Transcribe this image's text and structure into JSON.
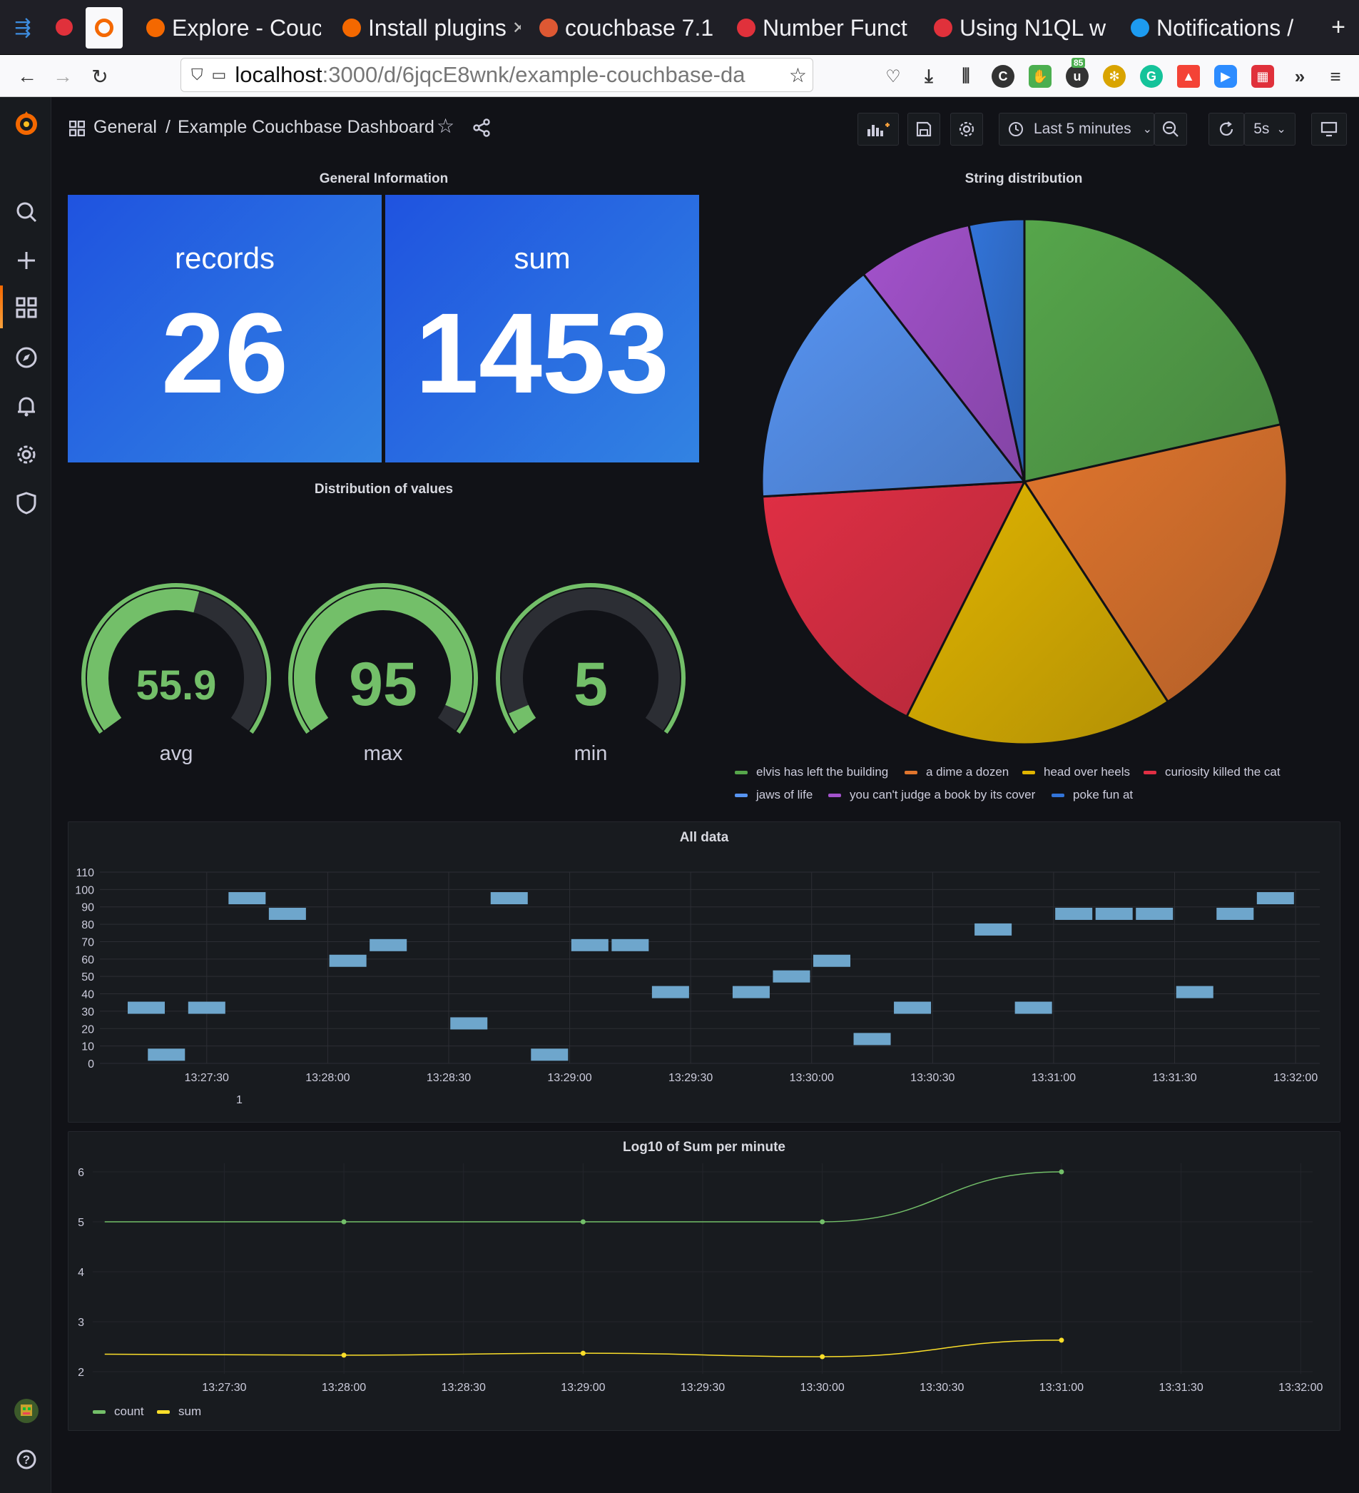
{
  "browser": {
    "tabs": [
      {
        "label": "Explore - Couc",
        "fav": "#f46800"
      },
      {
        "label": "Install plugins",
        "fav": "#f46800"
      },
      {
        "label": "couchbase 7.1",
        "fav": "#de5833"
      },
      {
        "label": "Number Funct",
        "fav": "#e0313b"
      },
      {
        "label": "Using N1QL w",
        "fav": "#e0313b"
      },
      {
        "label": "Notifications /",
        "fav": "#1d9bf0"
      }
    ],
    "url_host": "localhost",
    "url_path": ":3000/d/6jqcE8wnk/example-couchbase-da",
    "ext_badge": "85"
  },
  "header": {
    "folder": "General",
    "separator": "/",
    "title": "Example Couchbase Dashboard",
    "time_range": "Last 5 minutes",
    "refresh": "5s"
  },
  "general_info": {
    "title": "General Information",
    "records_label": "records",
    "records_value": "26",
    "sum_label": "sum",
    "sum_value": "1453"
  },
  "distribution": {
    "title": "Distribution of values",
    "gauges": [
      {
        "label": "avg",
        "display": "55.9",
        "value": 55.9
      },
      {
        "label": "max",
        "display": "95",
        "value": 95
      },
      {
        "label": "min",
        "display": "5",
        "value": 5
      }
    ],
    "gauge_min": 0,
    "gauge_max": 100,
    "colors": {
      "green": "#73bf69",
      "track": "#2c2e34"
    }
  },
  "string_distribution": {
    "title": "String distribution",
    "slices": [
      {
        "name": "elvis has left the building",
        "value": 21.5,
        "color": "#56a64b"
      },
      {
        "name": "a dime a dozen",
        "value": 19.3,
        "color": "#e0752d"
      },
      {
        "name": "head over heels",
        "value": 16.6,
        "color": "#e0b400"
      },
      {
        "name": "curiosity killed the cat",
        "value": 16.7,
        "color": "#e02f44"
      },
      {
        "name": "jaws of life",
        "value": 15.4,
        "color": "#5794f2"
      },
      {
        "name": "you can't judge a book by its cover",
        "value": 7.1,
        "color": "#a352cc"
      },
      {
        "name": "poke fun at",
        "value": 3.4,
        "color": "#3274d9"
      }
    ]
  },
  "all_data": {
    "title": "All data",
    "x_ticks": [
      "13:27:30",
      "13:28:00",
      "13:28:30",
      "13:29:00",
      "13:29:30",
      "13:30:00",
      "13:30:30",
      "13:31:00",
      "13:31:30",
      "13:32:00"
    ],
    "y_ticks": [
      "110",
      "100",
      "90",
      "80",
      "70",
      "60",
      "50",
      "40",
      "30",
      "20",
      "10",
      "0"
    ],
    "footer_label": "1",
    "color": "#6ea6cc"
  },
  "log_panel": {
    "title": "Log10 of Sum per minute",
    "x_ticks": [
      "13:27:30",
      "13:28:00",
      "13:28:30",
      "13:29:00",
      "13:29:30",
      "13:30:00",
      "13:30:30",
      "13:31:00",
      "13:31:30",
      "13:32:00"
    ],
    "y_ticks": [
      "6",
      "5",
      "4",
      "3",
      "2"
    ],
    "legend": [
      {
        "name": "count",
        "color": "#73bf69"
      },
      {
        "name": "sum",
        "color": "#fade2a"
      }
    ]
  },
  "chart_data": [
    {
      "type": "bar",
      "title": "All data",
      "xlabel": "",
      "ylabel": "",
      "ylim": [
        0,
        110
      ],
      "x": [
        "13:27:15",
        "13:27:20",
        "13:27:30",
        "13:27:40",
        "13:27:50",
        "13:28:05",
        "13:28:15",
        "13:28:35",
        "13:28:45",
        "13:28:55",
        "13:29:05",
        "13:29:15",
        "13:29:25",
        "13:29:45",
        "13:29:55",
        "13:30:05",
        "13:30:15",
        "13:30:25",
        "13:30:45",
        "13:30:55",
        "13:31:05",
        "13:31:15",
        "13:31:25",
        "13:31:35",
        "13:31:45",
        "13:31:55"
      ],
      "values": [
        32,
        5,
        32,
        95,
        86,
        59,
        68,
        23,
        95,
        5,
        68,
        68,
        41,
        41,
        50,
        59,
        14,
        32,
        77,
        32,
        86,
        86,
        86,
        41,
        86,
        95
      ]
    },
    {
      "type": "line",
      "title": "Log10 of Sum per minute",
      "x": [
        "13:27:00",
        "13:28:00",
        "13:29:00",
        "13:30:00",
        "13:31:00"
      ],
      "ylim": [
        2,
        6.5
      ],
      "series": [
        {
          "name": "count",
          "values": [
            5,
            5,
            5,
            5,
            6
          ]
        },
        {
          "name": "sum",
          "values": [
            2.35,
            2.33,
            2.37,
            2.3,
            2.63
          ]
        }
      ]
    },
    {
      "type": "pie",
      "title": "String distribution",
      "categories": [
        "elvis has left the building",
        "a dime a dozen",
        "head over heels",
        "curiosity killed the cat",
        "jaws of life",
        "you can't judge a book by its cover",
        "poke fun at"
      ],
      "values": [
        21.5,
        19.3,
        16.6,
        16.7,
        15.4,
        7.1,
        3.4
      ]
    }
  ]
}
